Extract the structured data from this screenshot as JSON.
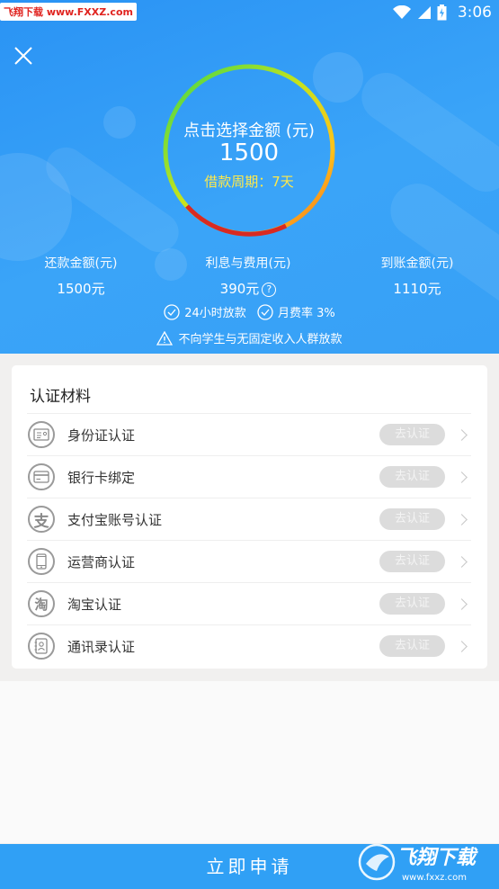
{
  "status_bar": {
    "watermark": "飞翔下载 www.FXXZ.com",
    "time": "3:06"
  },
  "gauge": {
    "title": "点击选择金额 (元)",
    "amount": "1500",
    "period": "借款周期：7天"
  },
  "stats": [
    {
      "label": "还款金额(元)",
      "value": "1500元"
    },
    {
      "label": "利息与费用(元)",
      "value": "390元"
    },
    {
      "label": "到账金额(元)",
      "value": "1110元"
    }
  ],
  "badges": [
    "24小时放款",
    "月费率 3%"
  ],
  "warning": "不向学生与无固定收入人群放款",
  "auth": {
    "title": "认证材料",
    "items": [
      {
        "label": "身份证认证",
        "button": "去认证",
        "icon": "id-card-icon"
      },
      {
        "label": "银行卡绑定",
        "button": "去认证",
        "icon": "bank-card-icon"
      },
      {
        "label": "支付宝账号认证",
        "button": "去认证",
        "icon": "alipay-icon"
      },
      {
        "label": "运营商认证",
        "button": "去认证",
        "icon": "phone-icon"
      },
      {
        "label": "淘宝认证",
        "button": "去认证",
        "icon": "taobao-icon"
      },
      {
        "label": "通讯录认证",
        "button": "去认证",
        "icon": "contacts-icon"
      }
    ]
  },
  "apply_button": "立即申请",
  "watermark_bottom": {
    "brand": "飞翔下载",
    "url": "www.fxxz.com"
  }
}
